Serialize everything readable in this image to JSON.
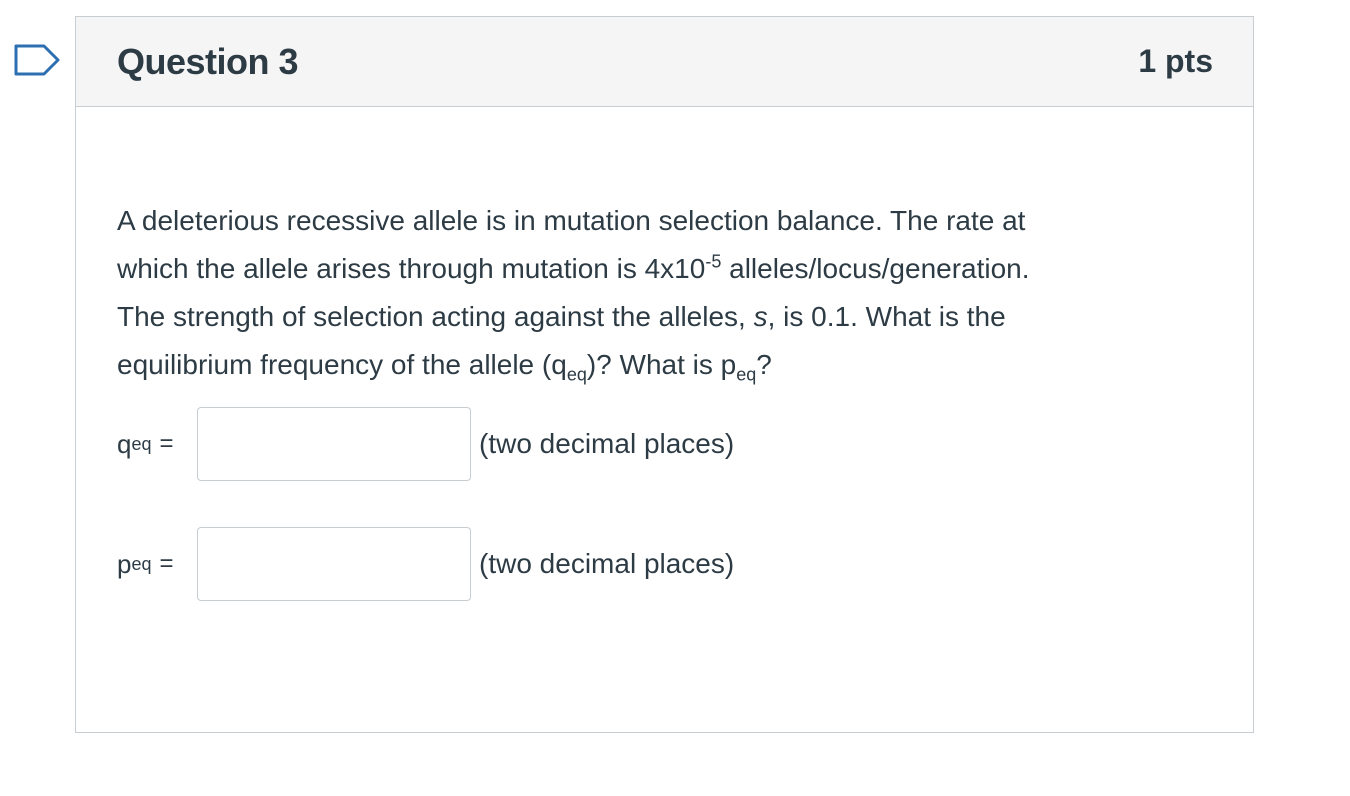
{
  "question": {
    "title": "Question 3",
    "points": "1 pts",
    "prompt": {
      "line1": "A deleterious recessive allele is in mutation selection balance. The rate at",
      "line2_a": "which the allele arises through mutation is 4x10",
      "line2_sup": "-5",
      "line2_b": " alleles/locus/generation.",
      "line3_a": "The strength of selection acting against the alleles, ",
      "line3_s": "s",
      "line3_b": ", is 0.1. What is the",
      "line4_a": "equilibrium frequency of the allele (q",
      "line4_sub1": "eq",
      "line4_b": ")? What is p",
      "line4_sub2": "eq",
      "line4_c": "?"
    },
    "answers": [
      {
        "var": "q",
        "sub": "eq",
        "equals": "=",
        "value": "",
        "hint": "(two decimal places)"
      },
      {
        "var": "p",
        "sub": "eq",
        "equals": "=",
        "value": "",
        "hint": "(two decimal places)"
      }
    ]
  },
  "icons": {
    "flag": "flag-question-icon"
  },
  "colors": {
    "text": "#2d3b45",
    "border": "#c7cdd1",
    "header_bg": "#f5f5f5",
    "flag": "#2d6fb0"
  }
}
